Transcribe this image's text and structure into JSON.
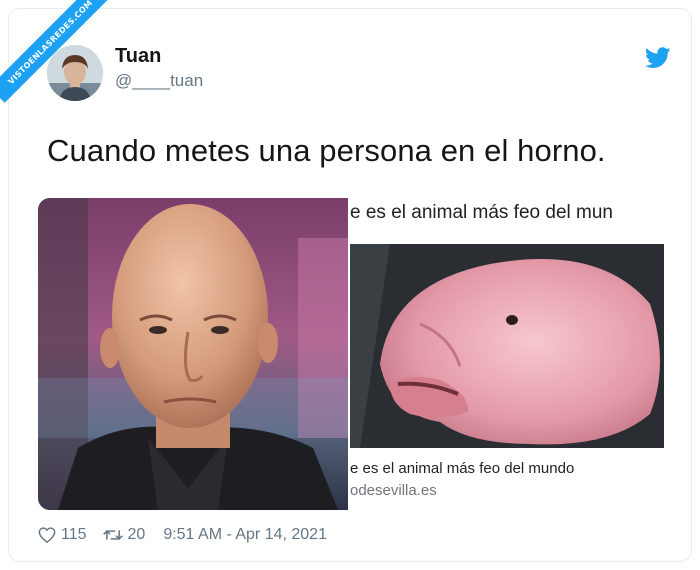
{
  "watermark": {
    "text": "VISTOENLASREDES.COM"
  },
  "tweet": {
    "display_name": "Tuan",
    "handle": "@____tuan",
    "text": "Cuando metes una persona en el horno."
  },
  "media": {
    "right_headline": "e es el animal más feo del mun",
    "right_caption": "e es el animal más feo del mundo",
    "right_domain": "odesevilla.es"
  },
  "footer": {
    "likes": "115",
    "retweets": "20",
    "timestamp": "9:51 AM - Apr 14, 2021"
  },
  "colors": {
    "accent": "#1da1f2",
    "text": "#14171a",
    "muted": "#657786"
  },
  "icons": [
    "twitter-bird-icon",
    "heart-icon",
    "retweet-icon"
  ]
}
